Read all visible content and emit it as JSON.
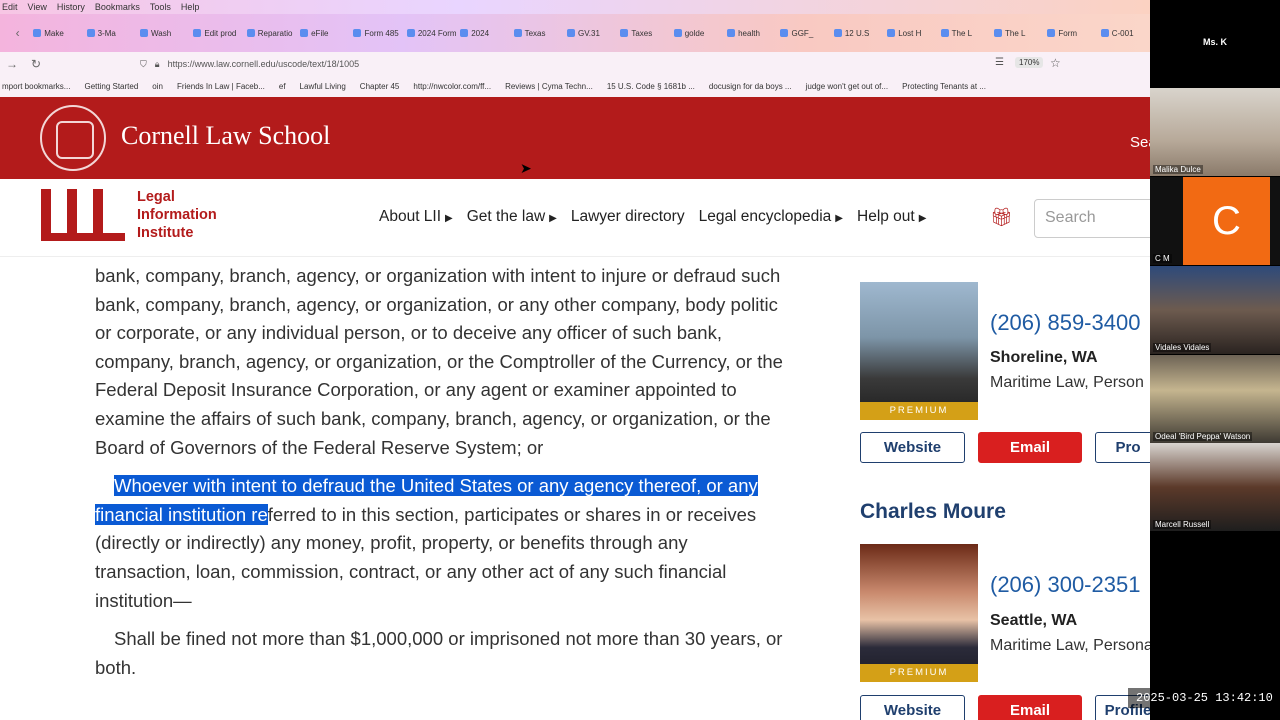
{
  "browser": {
    "menu": [
      "Edit",
      "View",
      "History",
      "Bookmarks",
      "Tools",
      "Help"
    ],
    "tabs": [
      "Make",
      "3-Ma",
      "Wash",
      "Edit prod",
      "Reparatio",
      "eFile",
      "Form 485",
      "2024 Form",
      "2024",
      "Texas",
      "GV.31",
      "Taxes",
      "golde",
      "health",
      "GGF_",
      "12 U.S",
      "Lost H",
      "The L",
      "The L",
      "Form",
      "C-001"
    ],
    "url": "https://www.law.cornell.edu/uscode/text/18/1005",
    "zoom": "170%",
    "bookmarks": [
      "mport bookmarks...",
      "Getting Started",
      "oin",
      "Friends In Law | Faceb...",
      "ef",
      "Lawful Living",
      "Chapter 45",
      "http://nwcolor.com/ff...",
      "Reviews | Cyma Techn...",
      "15 U.S. Code § 1681b ...",
      "docusign for da boys ...",
      "judge won't get out of...",
      "Protecting Tenants at ..."
    ]
  },
  "header": {
    "school": "Cornell Law School",
    "search_label": "Sea"
  },
  "lii": {
    "logo_text": "Legal Information Institute",
    "nav": [
      "About LII",
      "Get the law",
      "Lawyer directory",
      "Legal encyclopedia",
      "Help out"
    ],
    "search_placeholder": "Search"
  },
  "article": {
    "para1": "bank, company, branch, agency, or organization with intent to injure or defraud such bank, company, branch, agency, or organization, or any other company, body politic or corporate, or any individual person, or to deceive any officer of such bank, company, branch, agency, or organization, or the Comptroller of the Currency, or the Federal Deposit Insurance Corporation, or any agent or examiner appointed to examine the affairs of such bank, company, branch, agency, or organization, or the Board of Governors of the Federal Reserve System; or",
    "para2_highlight": "Whoever with intent to defraud the United States or any agency thereof, or any financial institution re",
    "para2_rest": "ferred to in this section, participates or shares in or receives (directly or indirectly) any money, profit, property, or benefits through any transaction, loan, commission, contract, or any other act of any such financial institution—",
    "para3": "Shall be fined not more than $1,000,000 or imprisoned not more than 30 years, or both."
  },
  "lawyers": [
    {
      "name": "",
      "phone": "(206) 859-3400",
      "city": "Shoreline, WA",
      "area": "Maritime Law, Person",
      "badge": "PREMIUM",
      "website": "Website",
      "email": "Email",
      "profile": "Pro"
    },
    {
      "name": "Charles Moure",
      "phone": "(206) 300-2351",
      "city": "Seattle, WA",
      "area": "Maritime Law, Personal I...",
      "badge": "PREMIUM",
      "website": "Website",
      "email": "Email",
      "profile": "Profile"
    }
  ],
  "call": {
    "host": "Ms. K",
    "participants": [
      "Malika Dulce",
      "C M",
      "Vidales Vidales",
      "Odeal 'Bird Peppa' Watson",
      "Marcell Russell"
    ],
    "avatar_letter": "C",
    "timestamp": "2025-03-25  13:42:10"
  }
}
